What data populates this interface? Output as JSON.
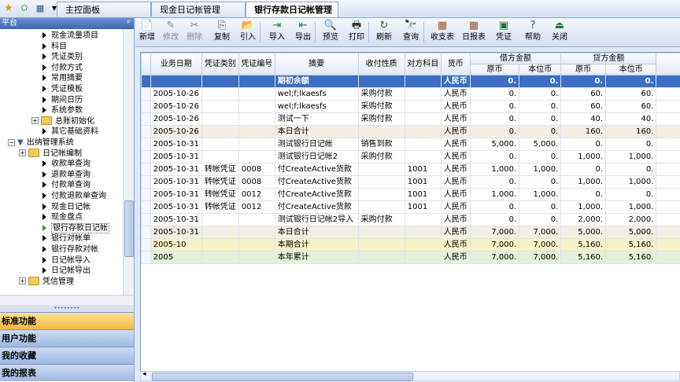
{
  "topbar": {
    "tabs": [
      {
        "label": "主控面板"
      },
      {
        "label": "现金日记帐管理"
      },
      {
        "label": "银行存款日记帐管理",
        "close": "✕"
      }
    ]
  },
  "sidebar": {
    "title": "平台",
    "items": [
      {
        "label": "现金流量项目",
        "kind": "leaf",
        "level": 3
      },
      {
        "label": "科目",
        "kind": "leaf",
        "level": 3
      },
      {
        "label": "凭证类别",
        "kind": "leaf",
        "level": 3
      },
      {
        "label": "付款方式",
        "kind": "leaf",
        "level": 3
      },
      {
        "label": "常用摘要",
        "kind": "leaf",
        "level": 3
      },
      {
        "label": "凭证模板",
        "kind": "leaf",
        "level": 3
      },
      {
        "label": "期间日历",
        "kind": "leaf",
        "level": 3
      },
      {
        "label": "系统参数",
        "kind": "leaf",
        "level": 3
      },
      {
        "label": "总账初始化",
        "kind": "folder",
        "level": 2
      },
      {
        "label": "其它基础资料",
        "kind": "leaf",
        "level": 3
      },
      {
        "label": "出纳管理系统",
        "kind": "root",
        "level": 1
      },
      {
        "label": "日记帐编制",
        "kind": "folder",
        "level": 2
      },
      {
        "label": "收款单查询",
        "kind": "leaf",
        "level": 3
      },
      {
        "label": "退款单查询",
        "kind": "leaf",
        "level": 3
      },
      {
        "label": "付款单查询",
        "kind": "leaf",
        "level": 3
      },
      {
        "label": "付款退款单查询",
        "kind": "leaf",
        "level": 3
      },
      {
        "label": "现金日记帐",
        "kind": "leaf",
        "level": 3
      },
      {
        "label": "现金盘点",
        "kind": "leaf",
        "level": 3
      },
      {
        "label": "银行存款日记帐",
        "kind": "active",
        "level": 3
      },
      {
        "label": "银行对帐单",
        "kind": "leaf",
        "level": 3
      },
      {
        "label": "银行存款对帐",
        "kind": "leaf",
        "level": 3
      },
      {
        "label": "日记帐导入",
        "kind": "leaf",
        "level": 3
      },
      {
        "label": "日记帐导出",
        "kind": "leaf",
        "level": 3
      },
      {
        "label": "凭信管理",
        "kind": "folder",
        "level": 2
      }
    ],
    "panels": [
      {
        "label": "标准功能"
      },
      {
        "label": "用户功能"
      },
      {
        "label": "我的收藏"
      },
      {
        "label": "我的报表"
      }
    ]
  },
  "toolbar": {
    "buttons": [
      {
        "label": "新增",
        "icon": "📄",
        "name": "add",
        "disabled": false
      },
      {
        "label": "修改",
        "icon": "✎",
        "name": "edit",
        "disabled": true
      },
      {
        "label": "删除",
        "icon": "✂",
        "name": "delete",
        "disabled": true
      },
      {
        "label": "复制",
        "icon": "⎘",
        "name": "copy",
        "disabled": false
      },
      {
        "label": "引入",
        "icon": "📂",
        "name": "import-ref",
        "disabled": false
      },
      {
        "label": "导入",
        "icon": "⇥",
        "name": "import",
        "disabled": false
      },
      {
        "label": "导出",
        "icon": "⇤",
        "name": "export",
        "disabled": false
      },
      {
        "label": "预览",
        "icon": "🔍",
        "name": "preview",
        "disabled": false
      },
      {
        "label": "打印",
        "icon": "🖶",
        "name": "print",
        "disabled": false
      },
      {
        "label": "刷新",
        "icon": "↻",
        "name": "refresh",
        "disabled": false
      },
      {
        "label": "查询",
        "icon": "🔭",
        "name": "query",
        "disabled": false
      },
      {
        "label": "收支表",
        "icon": "▦",
        "name": "income-expense",
        "disabled": false
      },
      {
        "label": "日报表",
        "icon": "▦",
        "name": "daily-report",
        "disabled": false
      },
      {
        "label": "凭证",
        "icon": "▣",
        "name": "voucher",
        "disabled": false
      },
      {
        "label": "帮助",
        "icon": "?",
        "name": "help",
        "disabled": false
      },
      {
        "label": "关闭",
        "icon": "⏏",
        "name": "close",
        "disabled": false
      }
    ]
  },
  "grid": {
    "headers": {
      "date": "业务日期",
      "vtype": "凭证类别",
      "vno": "凭证编号",
      "summary": "摘要",
      "nature": "收付性质",
      "account": "对方科目",
      "currency": "货币",
      "debit": "借方金额",
      "credit": "贷方金额",
      "orig": "原币",
      "local": "本位币"
    },
    "rows": [
      {
        "type": "sel",
        "date": "",
        "vtype": "",
        "vno": "",
        "summary": "期初余额",
        "nature": "",
        "account": "",
        "currency": "人民币",
        "d_orig": "0.",
        "d_local": "0.",
        "c_orig": "0.",
        "c_local": "0."
      },
      {
        "type": "",
        "date": "2005-10-26",
        "vtype": "",
        "vno": "",
        "summary": "wel;f;lkaesfs",
        "nature": "采购付款",
        "account": "",
        "currency": "人民币",
        "d_orig": "0.",
        "d_local": "0.",
        "c_orig": "60.",
        "c_local": "60."
      },
      {
        "type": "",
        "date": "2005-10-26",
        "vtype": "",
        "vno": "",
        "summary": "wel;f;lkaesfs",
        "nature": "采购付款",
        "account": "",
        "currency": "人民币",
        "d_orig": "0.",
        "d_local": "0.",
        "c_orig": "60.",
        "c_local": "60."
      },
      {
        "type": "",
        "date": "2005-10-26",
        "vtype": "",
        "vno": "",
        "summary": "测试一下",
        "nature": "采购付款",
        "account": "",
        "currency": "人民币",
        "d_orig": "0.",
        "d_local": "0.",
        "c_orig": "40.",
        "c_local": "40."
      },
      {
        "type": "sum",
        "date": "2005-10-26",
        "vtype": "",
        "vno": "",
        "summary": "本日合计",
        "nature": "",
        "account": "",
        "currency": "人民币",
        "d_orig": "0.",
        "d_local": "0.",
        "c_orig": "160.",
        "c_local": "160."
      },
      {
        "type": "",
        "date": "2005-10-31",
        "vtype": "",
        "vno": "",
        "summary": "测试银行日记帐",
        "nature": "销售到款",
        "account": "",
        "currency": "人民币",
        "d_orig": "5,000.",
        "d_local": "5,000.",
        "c_orig": "0.",
        "c_local": "0."
      },
      {
        "type": "",
        "date": "2005-10-31",
        "vtype": "",
        "vno": "",
        "summary": "测试银行日记帐2",
        "nature": "采购付款",
        "account": "",
        "currency": "人民币",
        "d_orig": "0.",
        "d_local": "0.",
        "c_orig": "1,000.",
        "c_local": "1,000."
      },
      {
        "type": "",
        "date": "2005-10-31",
        "vtype": "转帐凭证",
        "vno": "0008",
        "summary": "付CreateActive货款",
        "nature": "",
        "account": "1001",
        "currency": "人民币",
        "d_orig": "1,000.",
        "d_local": "1,000.",
        "c_orig": "0.",
        "c_local": "0."
      },
      {
        "type": "",
        "date": "2005-10-31",
        "vtype": "转帐凭证",
        "vno": "0008",
        "summary": "付CreateActive货款",
        "nature": "",
        "account": "1001",
        "currency": "人民币",
        "d_orig": "0.",
        "d_local": "0.",
        "c_orig": "1,000.",
        "c_local": "1,000."
      },
      {
        "type": "",
        "date": "2005-10-31",
        "vtype": "转帐凭证",
        "vno": "0012",
        "summary": "付CreateActive货款",
        "nature": "",
        "account": "1001",
        "currency": "人民币",
        "d_orig": "1,000.",
        "d_local": "1,000.",
        "c_orig": "0.",
        "c_local": "0."
      },
      {
        "type": "",
        "date": "2005-10-31",
        "vtype": "转帐凭证",
        "vno": "0012",
        "summary": "付CreateActive货款",
        "nature": "",
        "account": "1001",
        "currency": "人民币",
        "d_orig": "0.",
        "d_local": "0.",
        "c_orig": "1,000.",
        "c_local": "1,000."
      },
      {
        "type": "",
        "date": "2005-10-31",
        "vtype": "",
        "vno": "",
        "summary": "测试银行日记帐2导入",
        "nature": "采购付款",
        "account": "",
        "currency": "人民币",
        "d_orig": "0.",
        "d_local": "0.",
        "c_orig": "2,000.",
        "c_local": "2,000."
      },
      {
        "type": "sum",
        "date": "2005-10-31",
        "vtype": "",
        "vno": "",
        "summary": "本日合计",
        "nature": "",
        "account": "",
        "currency": "人民币",
        "d_orig": "7,000.",
        "d_local": "7,000.",
        "c_orig": "5,000.",
        "c_local": "5,000."
      },
      {
        "type": "month",
        "date": "2005-10",
        "vtype": "",
        "vno": "",
        "summary": "本期合计",
        "nature": "",
        "account": "",
        "currency": "人民币",
        "d_orig": "7,000.",
        "d_local": "7,000.",
        "c_orig": "5,160.",
        "c_local": "5,160."
      },
      {
        "type": "year",
        "date": "2005",
        "vtype": "",
        "vno": "",
        "summary": "本年累计",
        "nature": "",
        "account": "",
        "currency": "人民币",
        "d_orig": "7,000.",
        "d_local": "7,000.",
        "c_orig": "5,160.",
        "c_local": "5,160."
      }
    ]
  }
}
